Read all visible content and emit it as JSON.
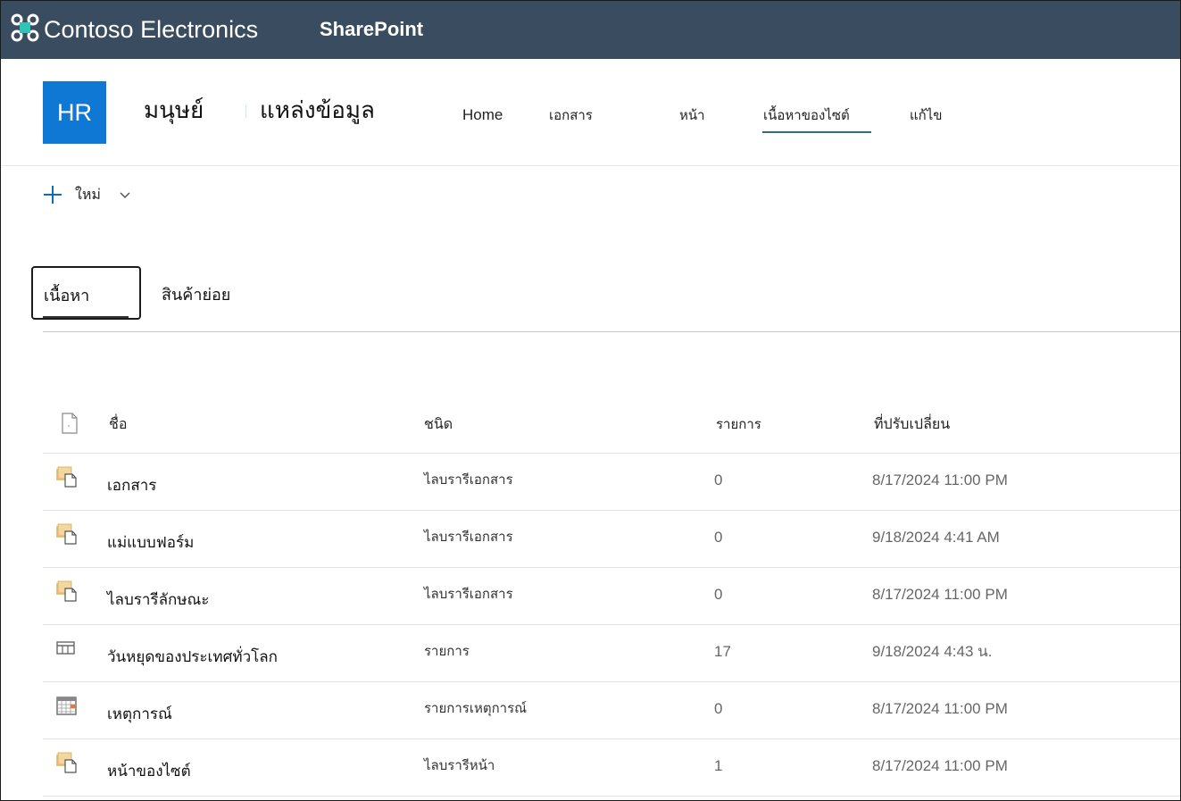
{
  "suite_bar": {
    "org_name": "Contoso Electronics",
    "app_name": "SharePoint",
    "background": "#3a4c60"
  },
  "site": {
    "logo_text": "HR",
    "logo_color": "#0f78d4",
    "title_part1": "มนุษย์",
    "title_part2": "แหล่งข้อมูล",
    "nav": [
      {
        "label": "Home"
      },
      {
        "label": "เอกสาร"
      },
      {
        "label": "หน้า"
      },
      {
        "label": "เนื้อหาของไซต์",
        "active": true
      },
      {
        "label": "แก้ไข"
      }
    ]
  },
  "command_bar": {
    "new_label": "ใหม่",
    "new_icon": "plus-icon"
  },
  "pivot": {
    "tabs": [
      {
        "label": "เนื้อหา",
        "selected": true
      },
      {
        "label": "สินค้าย่อย",
        "selected": false
      }
    ]
  },
  "table": {
    "columns": {
      "name": "ชื่อ",
      "type": "ชนิด",
      "items": "รายการ",
      "modified": "ที่ปรับเปลี่ยน"
    },
    "rows": [
      {
        "icon": "document-library-icon",
        "name": "เอกสาร",
        "type": "ไลบรารีเอกสาร",
        "items": "0",
        "modified": "8/17/2024 11:00 PM"
      },
      {
        "icon": "document-library-icon",
        "name": "แม่แบบฟอร์ม",
        "type": "ไลบรารีเอกสาร",
        "items": "0",
        "modified": "9/18/2024 4:41 AM"
      },
      {
        "icon": "document-library-icon",
        "name": "ไลบรารีลักษณะ",
        "type": "ไลบรารีเอกสาร",
        "items": "0",
        "modified": "8/17/2024 11:00 PM"
      },
      {
        "icon": "list-icon",
        "name": "วันหยุดของประเทศทั่วโลก",
        "type": "รายการ",
        "items": "17",
        "modified": "9/18/2024 4:43 น."
      },
      {
        "icon": "calendar-icon",
        "name": "เหตุการณ์",
        "type": "รายการเหตุการณ์",
        "items": "0",
        "modified": "8/17/2024 11:00 PM"
      },
      {
        "icon": "document-library-icon",
        "name": "หน้าของไซต์",
        "type": "ไลบรารีหน้า",
        "items": "1",
        "modified": "8/17/2024 11:00 PM"
      }
    ]
  }
}
